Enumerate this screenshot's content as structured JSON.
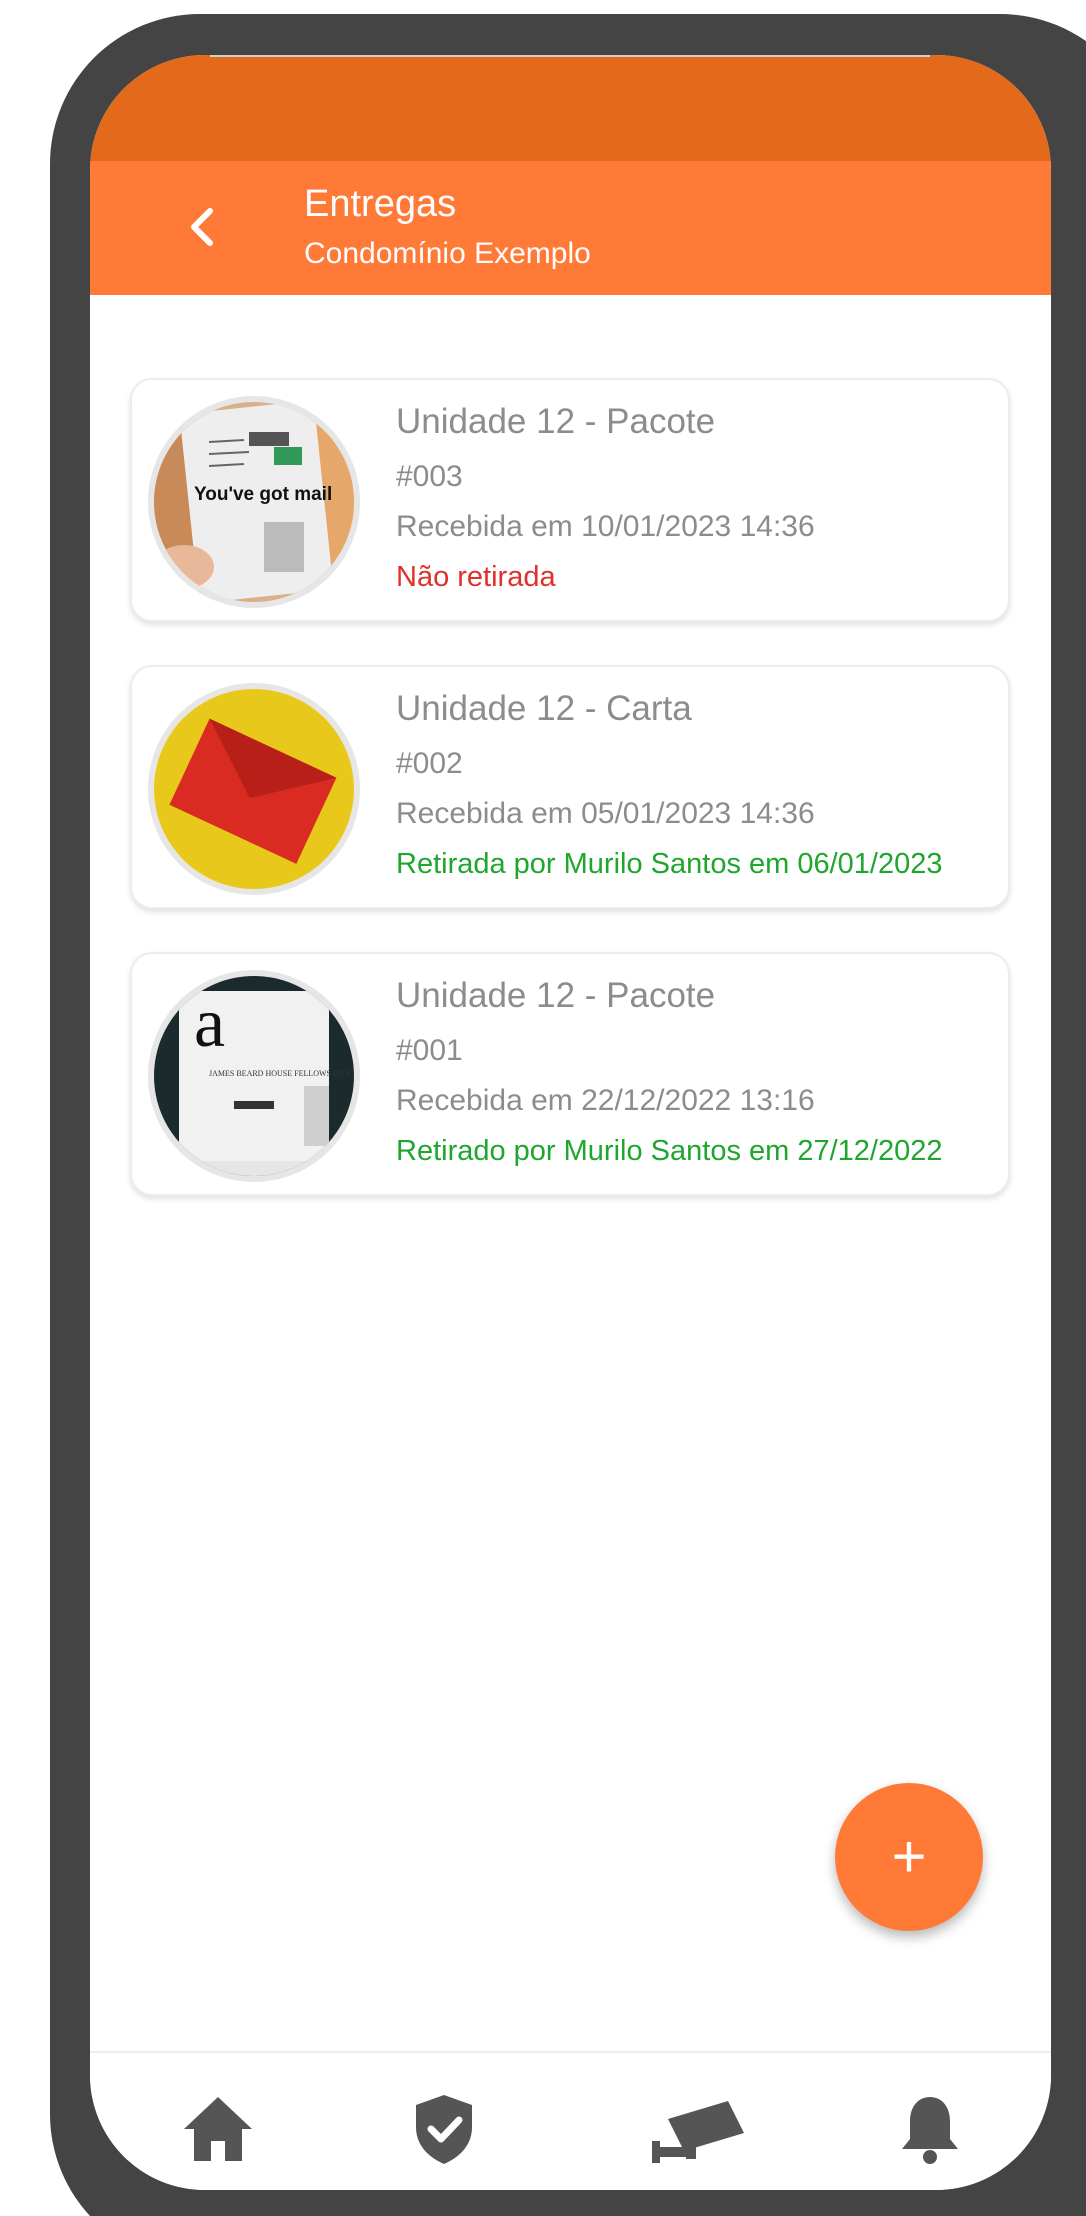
{
  "header": {
    "title": "Entregas",
    "subtitle": "Condomínio Exemplo"
  },
  "deliveries": [
    {
      "title": "Unidade 12 - Pacote",
      "code": "#003",
      "received": "Recebida em 10/01/2023 14:36",
      "status": "Não retirada",
      "status_color": "#E0302D",
      "image_text": "You've got mail"
    },
    {
      "title": "Unidade 12 - Carta",
      "code": "#002",
      "received": "Recebida em 05/01/2023 14:36",
      "status": "Retirada por Murilo Santos em 06/01/2023",
      "status_color": "#1FA62E"
    },
    {
      "title": "Unidade 12 - Pacote",
      "code": "#001",
      "received": "Recebida em 22/12/2022 13:16",
      "status": "Retirado por Murilo Santos em 27/12/2022",
      "status_color": "#1FA62E",
      "image_text": "JAMES BEARD HOUSE FELLOWS PROGRAM"
    }
  ],
  "fab": {
    "label": "+"
  },
  "bottom_nav": [
    {
      "icon": "home-icon"
    },
    {
      "icon": "shield-check-icon"
    },
    {
      "icon": "security-camera-icon"
    },
    {
      "icon": "bell-icon"
    }
  ],
  "colors": {
    "primary": "#FF7937",
    "status_bar": "#E46A1B",
    "frame": "#444444",
    "text_muted": "#8C8C8C"
  }
}
